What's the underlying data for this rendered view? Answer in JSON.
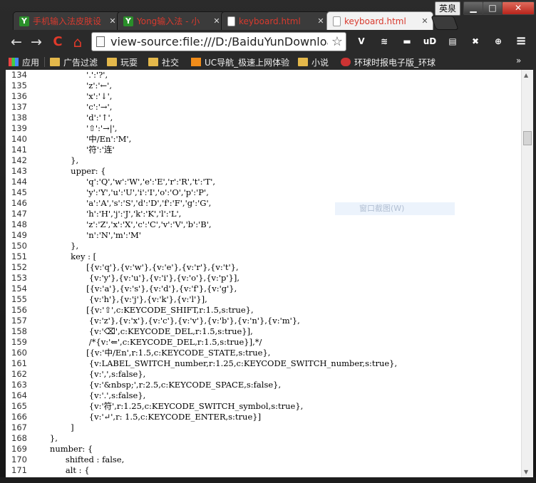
{
  "window": {
    "ime_label": "英泉",
    "min_glyph": "▁",
    "max_glyph": "□",
    "close_glyph": "✕"
  },
  "tabs": [
    {
      "label": "手机输入法皮肤设",
      "icon": "leaf-icon",
      "active": false
    },
    {
      "label": "Yong输入法 - 小",
      "icon": "leaf-icon",
      "active": false
    },
    {
      "label": "keyboard.html",
      "icon": "document-icon",
      "active": false
    },
    {
      "label": "keyboard.html",
      "icon": "document-icon",
      "active": true
    }
  ],
  "tab_close_glyph": "✕",
  "toolbar": {
    "back_glyph": "←",
    "forward_glyph": "→",
    "reload_glyph": "C",
    "home_glyph": "⌂",
    "url": "view-source:file:///D:/BaiduYunDownload",
    "star_glyph": "☆"
  },
  "extensions": [
    {
      "name": "v-extension-icon",
      "glyph": "V",
      "color": "#8a8a8a"
    },
    {
      "name": "stripes-extension-icon",
      "glyph": "≋",
      "color": "#e07020"
    },
    {
      "name": "gray-extension-icon",
      "glyph": "▬",
      "color": "#555555"
    },
    {
      "name": "ublock-extension-icon",
      "glyph": "uD",
      "color": "#b02020"
    },
    {
      "name": "image-extension-icon",
      "glyph": "▤",
      "color": "#777777"
    },
    {
      "name": "red-extension-icon",
      "glyph": "✖",
      "color": "#c02020"
    },
    {
      "name": "globe-extension-icon",
      "glyph": "⊕",
      "color": "#555555"
    },
    {
      "name": "menu-icon",
      "glyph": "≡",
      "color": "#2a2a2a"
    }
  ],
  "bookmarks": [
    {
      "label": "应用",
      "icon": "apps-icon"
    },
    {
      "label": "广告过滤",
      "icon": "folder-icon"
    },
    {
      "label": "玩耍",
      "icon": "folder-icon"
    },
    {
      "label": "社交",
      "icon": "folder-icon"
    },
    {
      "label": "UC导航_极速上网体验",
      "icon": "uc-icon"
    },
    {
      "label": "小说",
      "icon": "folder-icon"
    },
    {
      "label": "环球时报电子版_环球",
      "icon": "globe-icon"
    }
  ],
  "bookmarks_more": "»",
  "overlay_text": "窗口截图(W)",
  "code_lines": [
    {
      "n": "134",
      "t": "                    '.':'?',"
    },
    {
      "n": "135",
      "t": "                    'z':'←',"
    },
    {
      "n": "136",
      "t": "                    'x':'↓',"
    },
    {
      "n": "137",
      "t": "                    'c':'→',"
    },
    {
      "n": "138",
      "t": "                    'd':'↑',"
    },
    {
      "n": "139",
      "t": "                    '⇧':'→|',"
    },
    {
      "n": "140",
      "t": "                    '中/En':'M',"
    },
    {
      "n": "141",
      "t": "                    '符':'连'"
    },
    {
      "n": "142",
      "t": "              },"
    },
    {
      "n": "143",
      "t": "              upper: {"
    },
    {
      "n": "144",
      "t": "                    'q':'Q','w':'W','e':'E','r':'R','t':'T',"
    },
    {
      "n": "145",
      "t": "                    'y':'Y','u':'U','i':'I','o':'O','p':'P',"
    },
    {
      "n": "146",
      "t": "                    'a':'A','s':'S','d':'D','f':'F','g':'G',"
    },
    {
      "n": "147",
      "t": "                    'h':'H','j':'J','k':'K','l':'L',"
    },
    {
      "n": "148",
      "t": "                    'z':'Z','x':'X','c':'C','v':'V','b':'B',"
    },
    {
      "n": "149",
      "t": "                    'n':'N','m':'M'"
    },
    {
      "n": "150",
      "t": "              },"
    },
    {
      "n": "151",
      "t": "              key : ["
    },
    {
      "n": "152",
      "t": "                    [{v:'q'},{v:'w'},{v:'e'},{v:'r'},{v:'t'},"
    },
    {
      "n": "153",
      "t": "                     {v:'y'},{v:'u'},{v:'i'},{v:'o'},{v:'p'}],"
    },
    {
      "n": "154",
      "t": "                    [{v:'a'},{v:'s'},{v:'d'},{v:'f'},{v:'g'},"
    },
    {
      "n": "155",
      "t": "                     {v:'h'},{v:'j'},{v:'k'},{v:'l'}],"
    },
    {
      "n": "156",
      "t": "                    [{v:'⇧',c:KEYCODE_SHIFT,r:1.5,s:true},"
    },
    {
      "n": "157",
      "t": "                     {v:'z'},{v:'x'},{v:'c'},{v:'v'},{v:'b'},{v:'n'},{v:'m'},"
    },
    {
      "n": "158",
      "t": "                     {v:'⌫',c:KEYCODE_DEL,r:1.5,s:true}],"
    },
    {
      "n": "159",
      "t": "                     /*{v:'⇐',c:KEYCODE_DEL,r:1.5,s:true}],*/"
    },
    {
      "n": "160",
      "t": "                    [{v:'中/En',r:1.5,c:KEYCODE_STATE,s:true},"
    },
    {
      "n": "161",
      "t": "                     {v:LABEL_SWITCH_number,r:1.25,c:KEYCODE_SWITCH_number,s:true},"
    },
    {
      "n": "162",
      "t": "                     {v:',',s:false},"
    },
    {
      "n": "163",
      "t": "                     {v:'&nbsp;',r:2.5,c:KEYCODE_SPACE,s:false},"
    },
    {
      "n": "164",
      "t": "                     {v:'.',s:false},"
    },
    {
      "n": "165",
      "t": "                     {v:'符',r:1.25,c:KEYCODE_SWITCH_symbol,s:true},"
    },
    {
      "n": "166",
      "t": "                     {v:'↵',r: 1.5,c:KEYCODE_ENTER,s:true}]"
    },
    {
      "n": "167",
      "t": "              ]"
    },
    {
      "n": "168",
      "t": "      },"
    },
    {
      "n": "169",
      "t": "      number: {"
    },
    {
      "n": "170",
      "t": "            shifted : false,"
    },
    {
      "n": "171",
      "t": "            alt : {"
    }
  ],
  "scrollbar": {
    "up_glyph": "▲",
    "down_glyph": "▼"
  }
}
